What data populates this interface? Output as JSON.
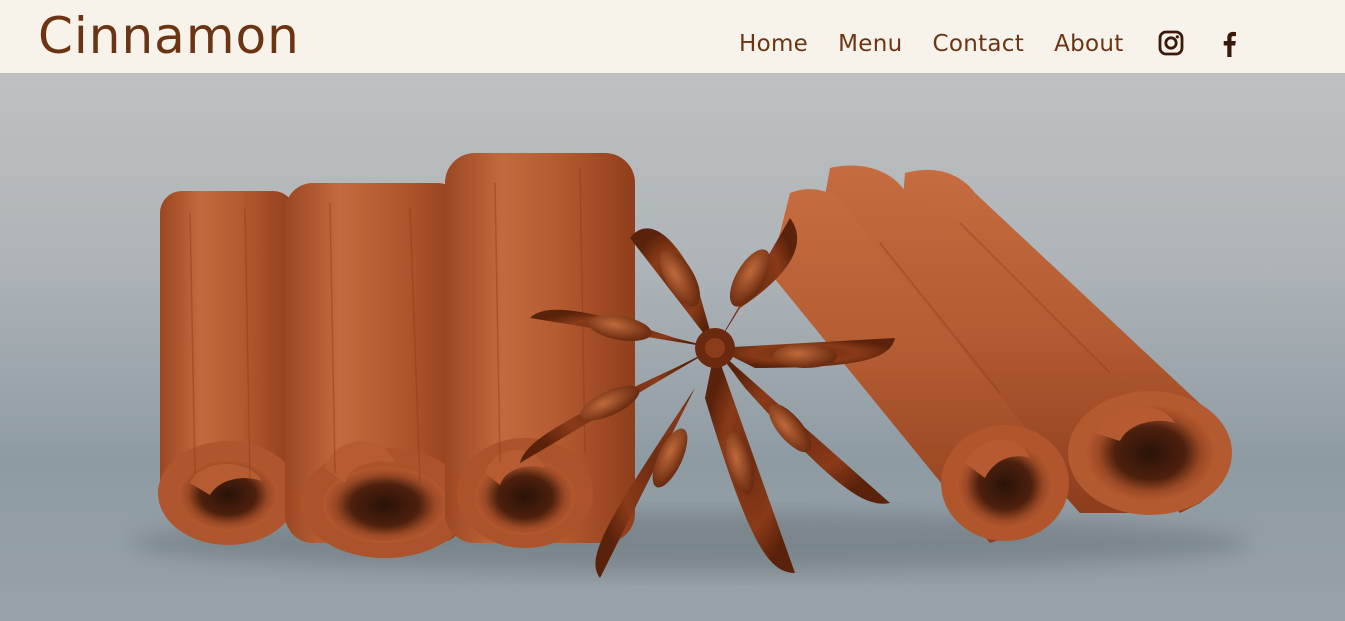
{
  "header": {
    "logo_text": "Cinnamon",
    "nav": {
      "home": "Home",
      "menu": "Menu",
      "contact": "Contact",
      "about": "About"
    },
    "social": {
      "instagram_icon": "instagram-icon",
      "facebook_icon": "facebook-icon"
    }
  },
  "hero": {
    "image_alt": "Cinnamon sticks and star anise"
  },
  "colors": {
    "header_bg": "#f7f2ea",
    "brand_brown": "#6b3514",
    "cinnamon": "#b5582e",
    "background_gray": "#9aa6ad"
  }
}
